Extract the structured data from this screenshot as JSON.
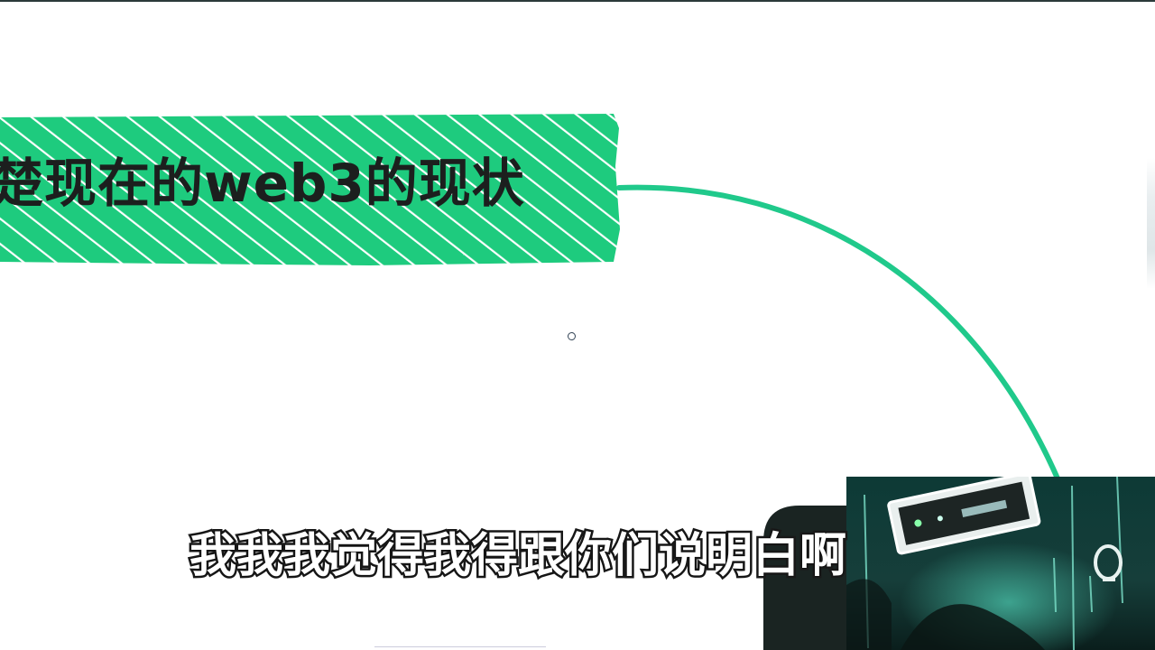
{
  "mindmap": {
    "topic_label": "楚现在的web3的现状",
    "accent_color": "#1ecb7e",
    "connector_color": "#20c98b"
  },
  "subtitle": {
    "text": "我我我觉得我得跟你们说明白啊"
  },
  "video_overlay": {
    "icon": "video-thumbnail-icon"
  }
}
